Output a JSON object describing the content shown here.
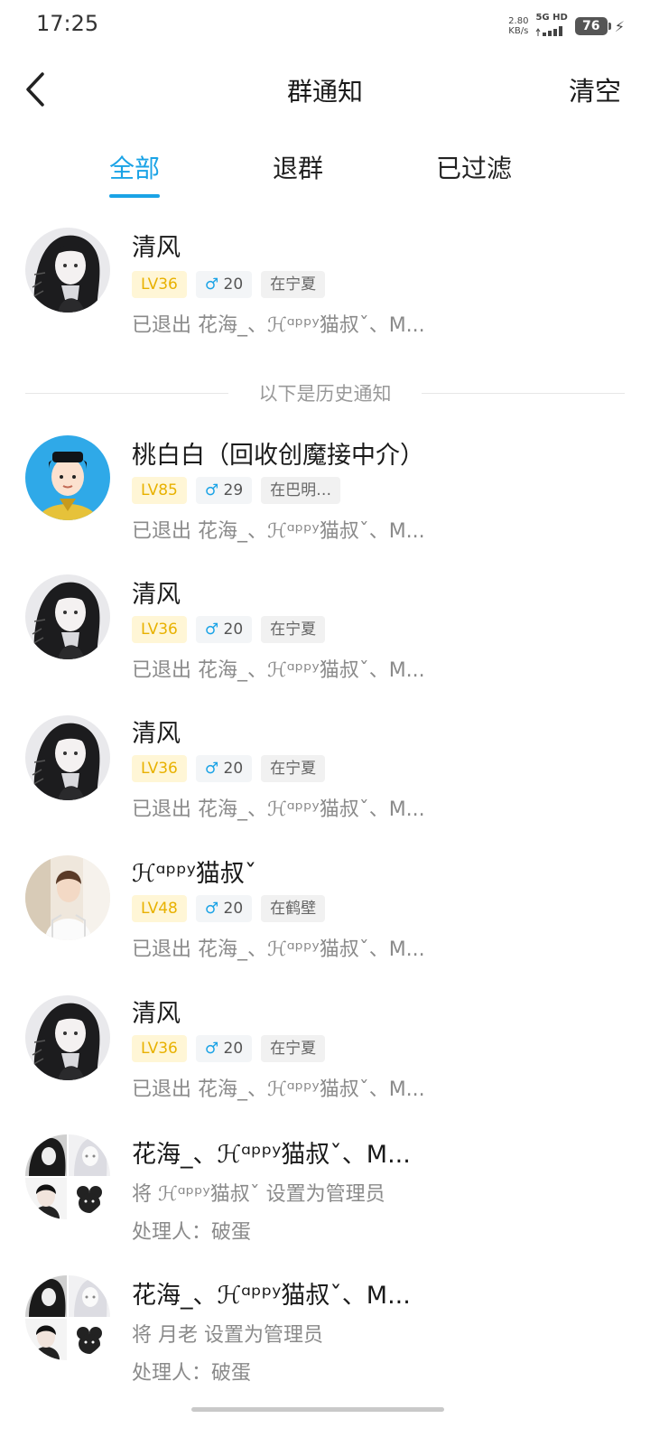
{
  "status_bar": {
    "time": "17:25",
    "net_speed": "2.80",
    "net_unit": "KB/s",
    "net_type": "5G HD",
    "battery": "76"
  },
  "header": {
    "title": "群通知",
    "clear_label": "清空"
  },
  "tabs": [
    {
      "label": "全部",
      "active": true
    },
    {
      "label": "退群",
      "active": false
    },
    {
      "label": "已过滤",
      "active": false
    }
  ],
  "history_divider": "以下是历史通知",
  "notifications": [
    {
      "name": "清风",
      "level": "LV36",
      "gender": "♂",
      "age": "20",
      "location": "在宁夏",
      "detail": "已退出 花海_、ℋᵅᵖᵖʸ猫叔ˇ、M..."
    },
    {
      "name": "桃白白（回收创魔接中介）",
      "level": "LV85",
      "gender": "♂",
      "age": "29",
      "location": "在巴明…",
      "detail": "已退出 花海_、ℋᵅᵖᵖʸ猫叔ˇ、M..."
    },
    {
      "name": "清风",
      "level": "LV36",
      "gender": "♂",
      "age": "20",
      "location": "在宁夏",
      "detail": "已退出 花海_、ℋᵅᵖᵖʸ猫叔ˇ、M..."
    },
    {
      "name": "清风",
      "level": "LV36",
      "gender": "♂",
      "age": "20",
      "location": "在宁夏",
      "detail": "已退出 花海_、ℋᵅᵖᵖʸ猫叔ˇ、M..."
    },
    {
      "name": "ℋᵅᵖᵖʸ猫叔ˇ",
      "level": "LV48",
      "gender": "♂",
      "age": "20",
      "location": "在鹤壁",
      "detail": "已退出 花海_、ℋᵅᵖᵖʸ猫叔ˇ、M..."
    },
    {
      "name": "清风",
      "level": "LV36",
      "gender": "♂",
      "age": "20",
      "location": "在宁夏",
      "detail": "已退出 花海_、ℋᵅᵖᵖʸ猫叔ˇ、M..."
    }
  ],
  "admin_notices": [
    {
      "title": "花海_、ℋᵅᵖᵖʸ猫叔ˇ、M...",
      "action": "将 ℋᵅᵖᵖʸ猫叔ˇ 设置为管理员",
      "handler": "处理人：破蛋"
    },
    {
      "title": "花海_、ℋᵅᵖᵖʸ猫叔ˇ、M...",
      "action": "将 月老 设置为管理员",
      "handler": "处理人：破蛋"
    }
  ]
}
